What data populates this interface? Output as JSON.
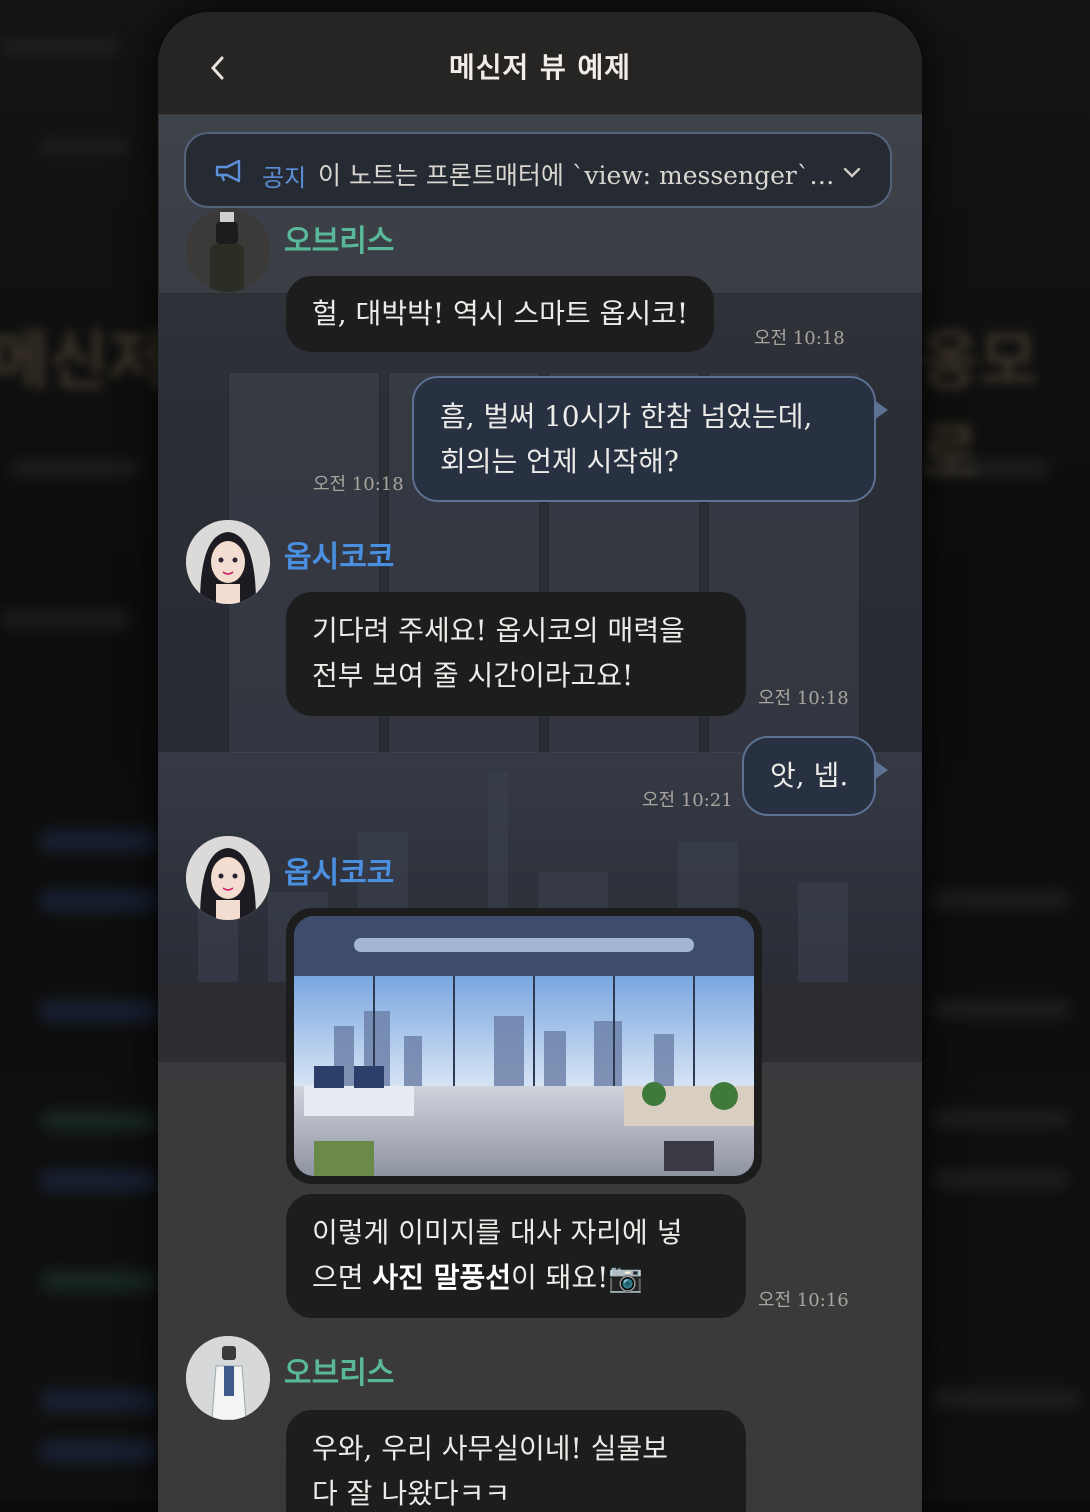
{
  "header": {
    "title": "메신저 뷰 예제",
    "back_icon": "chevron-left-icon"
  },
  "notice": {
    "label": "공지",
    "text": "이 노트는 프론트매터에 `view: messenger`…",
    "icon": "megaphone-icon",
    "expand_icon": "chevron-down-icon"
  },
  "colors": {
    "name_obris": "#5ab89a",
    "name_opsiko": "#4a8fe0",
    "out_bubble_bg": "#273142",
    "out_bubble_border": "#5d7192",
    "in_bubble_bg": "#1d1d1d",
    "notice_accent": "#5c8fd8"
  },
  "messages": [
    {
      "sender": "오브리스",
      "text": "헐, 대박박! 역시 스마트 옵시코!",
      "time": "오전 10:18"
    },
    {
      "sender": "me",
      "lines": [
        "흠, 벌써 10시가 한참 넘었는데,",
        "회의는 언제 시작해?"
      ],
      "time": "오전 10:18"
    },
    {
      "sender": "옵시코코",
      "lines": [
        "기다려 주세요! 옵시코의 매력을",
        "전부 보여 줄 시간이라고요!"
      ],
      "time": "오전 10:18"
    },
    {
      "sender": "me",
      "text": "앗, 넵.",
      "time": "오전 10:21"
    },
    {
      "sender": "옵시코코",
      "photo": "office-photo",
      "line1": "이렇게 이미지를 대사 자리에 넣",
      "line2_pre": "으면 ",
      "line2_bold": "사진 말풍선",
      "line2_post": "이 돼요!📷",
      "time": "오전 10:16"
    },
    {
      "sender": "오브리스",
      "lines": [
        "우와, 우리 사무실이네! 실물보",
        "다 잘 나왔다ㅋㅋ"
      ]
    }
  ]
}
